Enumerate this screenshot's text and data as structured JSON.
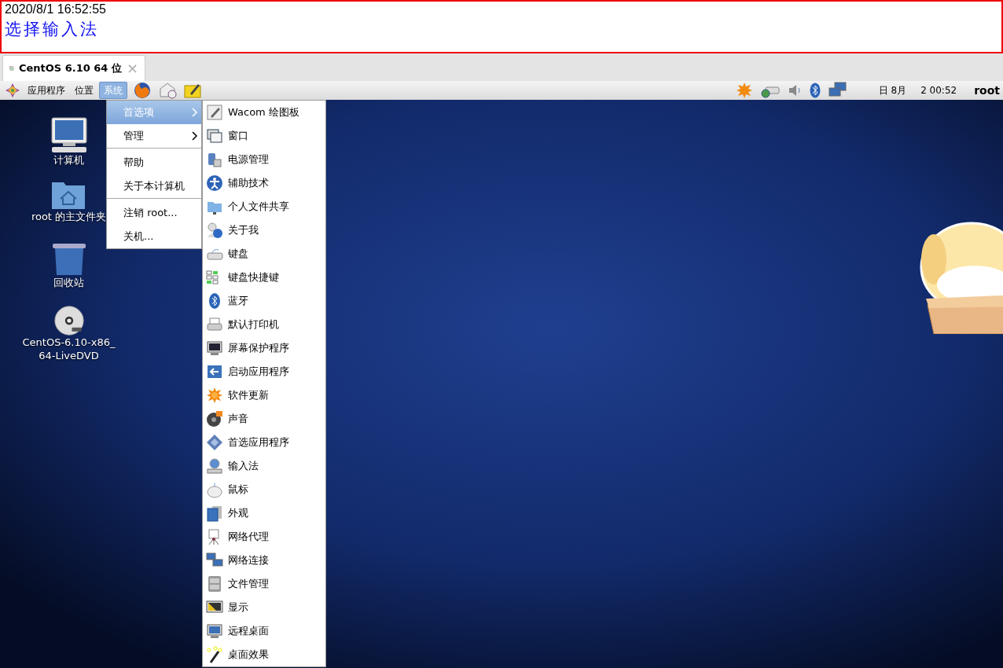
{
  "caption": {
    "timestamp": "2020/8/1 16:52:55",
    "title": "选择输入法"
  },
  "tab": {
    "label": "CentOS 6.10 64 位",
    "close": "×",
    "selected": true
  },
  "panel": {
    "menus": [
      {
        "label": "应用程序",
        "selected": false
      },
      {
        "label": "位置",
        "selected": false
      },
      {
        "label": "系统",
        "selected": true
      }
    ],
    "date": "日 8月",
    "time": "2 00:52",
    "user": "root"
  },
  "desktop_icons": [
    {
      "label": "计算机"
    },
    {
      "label": "root 的主文件夹"
    },
    {
      "label": "回收站"
    },
    {
      "label": "CentOS-6.10-x86_\n64-LiveDVD"
    }
  ],
  "system_menu": {
    "groups": [
      [
        {
          "label": "首选项",
          "has_submenu": true,
          "selected": true
        },
        {
          "label": "管理",
          "has_submenu": true,
          "selected": false
        }
      ],
      [
        {
          "label": "帮助",
          "has_submenu": false,
          "selected": false
        },
        {
          "label": "关于本计算机",
          "has_submenu": false,
          "selected": false
        }
      ],
      [
        {
          "label": "注销 root...",
          "has_submenu": false,
          "selected": false
        },
        {
          "label": "关机...",
          "has_submenu": false,
          "selected": false
        }
      ]
    ]
  },
  "preferences_menu": {
    "items": [
      "Wacom 绘图板",
      "窗口",
      "电源管理",
      "辅助技术",
      "个人文件共享",
      "关于我",
      "键盘",
      "键盘快捷键",
      "蓝牙",
      "默认打印机",
      "屏幕保护程序",
      "启动应用程序",
      "软件更新",
      "声音",
      "首选应用程序",
      "输入法",
      "鼠标",
      "外观",
      "网络代理",
      "网络连接",
      "文件管理",
      "显示",
      "远程桌面",
      "桌面效果"
    ]
  }
}
